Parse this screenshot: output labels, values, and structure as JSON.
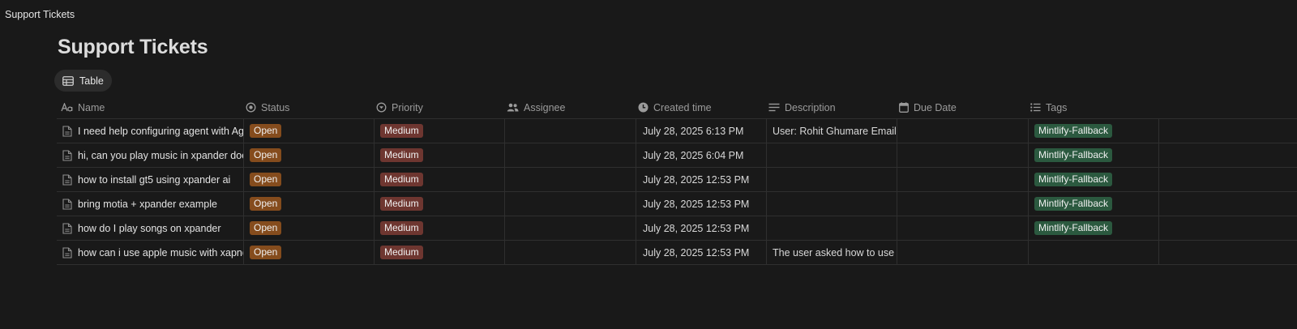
{
  "window_title": "Support Tickets",
  "page": {
    "title": "Support Tickets",
    "view_tab": "Table"
  },
  "icons": {
    "name_column": "text-aa-icon",
    "status_column": "status-circle-icon",
    "priority_column": "select-circle-icon",
    "assignee_column": "people-icon",
    "created_column": "clock-icon",
    "description_column": "text-lines-icon",
    "due_column": "calendar-icon",
    "tags_column": "list-icon",
    "row": "page-icon",
    "view_tab": "table-icon"
  },
  "colors": {
    "status_open": "#854c1d",
    "priority_medium": "#6e3630",
    "tag_mintlify": "#2b593f"
  },
  "columns": {
    "name": "Name",
    "status": "Status",
    "priority": "Priority",
    "assignee": "Assignee",
    "created": "Created time",
    "description": "Description",
    "due": "Due Date",
    "tags": "Tags"
  },
  "rows": [
    {
      "name": "I need help configuring agent with Agno",
      "status": "Open",
      "priority": "Medium",
      "assignee": "",
      "created": "July 28, 2025 6:13 PM",
      "description": "User: Rohit Ghumare Email: gh",
      "due": "",
      "tag": "Mintlify-Fallback"
    },
    {
      "name": "hi, can you play music in xpander docs",
      "status": "Open",
      "priority": "Medium",
      "assignee": "",
      "created": "July 28, 2025 6:04 PM",
      "description": "",
      "due": "",
      "tag": "Mintlify-Fallback"
    },
    {
      "name": "how to install gt5 using xpander ai",
      "status": "Open",
      "priority": "Medium",
      "assignee": "",
      "created": "July 28, 2025 12:53 PM",
      "description": "",
      "due": "",
      "tag": "Mintlify-Fallback"
    },
    {
      "name": "bring motia + xpander example",
      "status": "Open",
      "priority": "Medium",
      "assignee": "",
      "created": "July 28, 2025 12:53 PM",
      "description": "",
      "due": "",
      "tag": "Mintlify-Fallback"
    },
    {
      "name": "how do I play songs on xpander",
      "status": "Open",
      "priority": "Medium",
      "assignee": "",
      "created": "July 28, 2025 12:53 PM",
      "description": "",
      "due": "",
      "tag": "Mintlify-Fallback"
    },
    {
      "name": "how can i use apple music with xapnder",
      "status": "Open",
      "priority": "Medium",
      "assignee": "",
      "created": "July 28, 2025 12:53 PM",
      "description": "The user asked how to use Ap",
      "due": "",
      "tag": ""
    }
  ]
}
